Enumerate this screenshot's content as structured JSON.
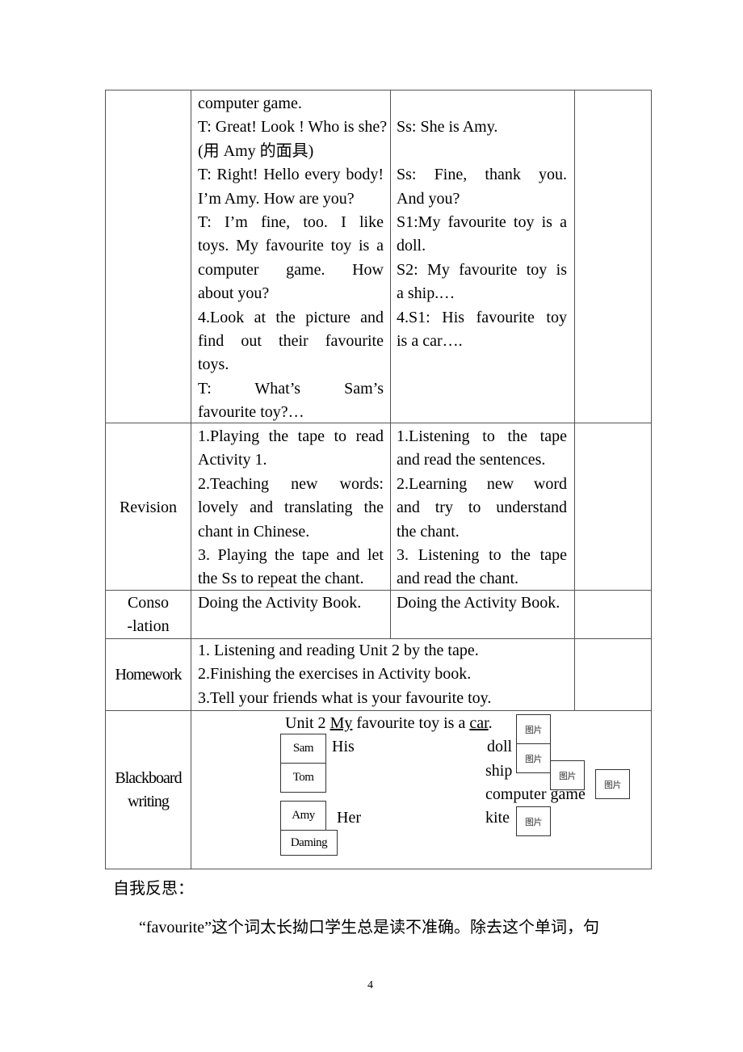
{
  "table": {
    "row_continued": {
      "label": "",
      "teacher": [
        [
          "computer game."
        ],
        [
          "T: Great! Look ! Who is she?"
        ],
        [
          "(用 Amy 的面具)"
        ],
        [
          "T: Right! Hello every body!",
          "I’m Amy. How are you?"
        ],
        [
          "T: I’m fine, too. I like",
          "toys. My favourite toy is a",
          "computer game. How",
          "about you?"
        ],
        [
          "4.Look at the picture and",
          "find out their favourite",
          "toys."
        ],
        [
          "T: What’s Sam’s",
          "favourite toy?…"
        ]
      ],
      "students": [
        [
          ""
        ],
        [
          "Ss: She is Amy."
        ],
        [
          ""
        ],
        [
          "Ss: Fine, thank you.",
          "And you?"
        ],
        [
          "S1:My favourite toy is a",
          "doll."
        ],
        [
          "S2: My favourite toy is",
          "a ship.…"
        ],
        [
          "4.S1: His favourite toy",
          "is a car…."
        ]
      ]
    },
    "row_revision": {
      "label": "Revision",
      "teacher": [
        [
          "1.Playing the tape to read",
          "Activity 1."
        ],
        [
          "2.Teaching new words:",
          "lovely and translating the",
          "chant in Chinese."
        ],
        [
          "3. Playing the tape and let",
          "the Ss to repeat the chant."
        ]
      ],
      "students": [
        [
          "1.Listening to the tape",
          "and read the sentences."
        ],
        [
          "2.Learning new word",
          "and try to understand",
          "the chant."
        ],
        [
          "3. Listening to the tape",
          "and read the chant."
        ]
      ]
    },
    "row_consolidation": {
      "label_lines": [
        "Conso",
        "-lation"
      ],
      "teacher": [
        [
          "Doing the Activity Book."
        ]
      ],
      "students": [
        [
          "Doing the Activity Book."
        ]
      ]
    },
    "row_homework": {
      "label": "Homework",
      "items": [
        "1. Listening and reading Unit 2 by the tape.",
        "2.Finishing the exercises in Activity book.",
        "3.Tell your friends what is your favourite toy."
      ]
    },
    "row_blackboard": {
      "label_lines": [
        "Blackboard",
        "writing"
      ],
      "title_pre": "Unit 2 ",
      "title_my": "My",
      "title_mid": " favourite toy is a ",
      "title_car": "car",
      "title_end": ".",
      "his": "His",
      "her": "Her",
      "names": [
        "Sam",
        "Tom",
        "Amy",
        "Daming"
      ],
      "toys": [
        "doll",
        "ship",
        "computer game",
        "kite"
      ],
      "picture_placeholder": "图片"
    }
  },
  "reflection": {
    "heading": "自我反思：",
    "text": "“favourite”这个词太长拗口学生总是读不准确。除去这个单词，句"
  },
  "page_number": "4"
}
